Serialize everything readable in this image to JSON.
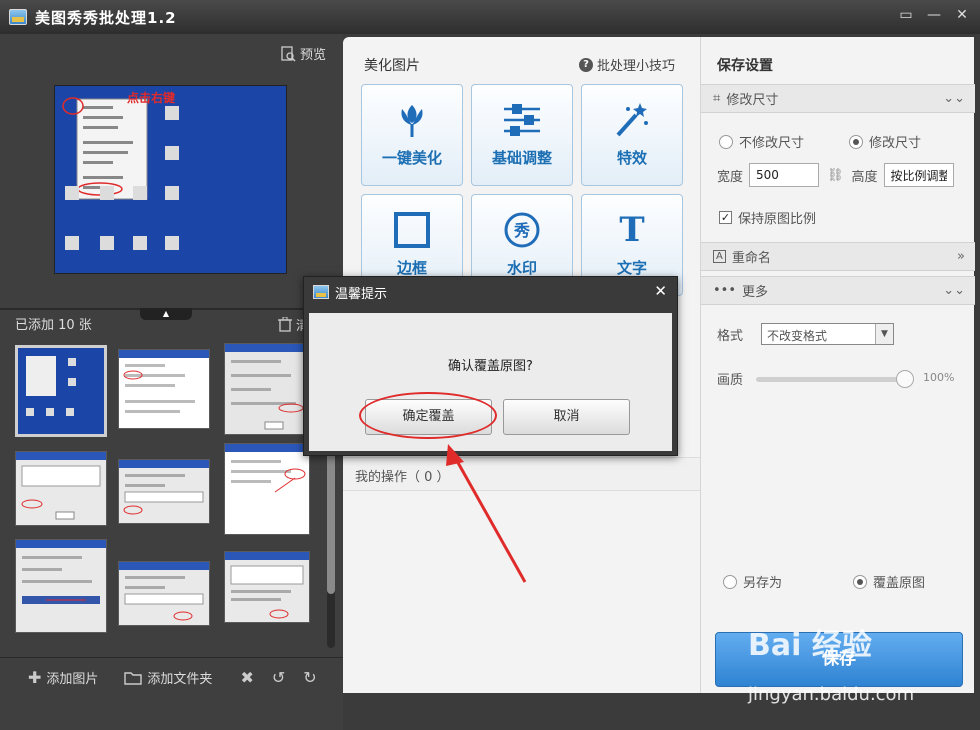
{
  "window": {
    "title": "美图秀秀批处理1.2",
    "buttons": {
      "feedback": "▭",
      "minimize": "—",
      "close": "✕"
    }
  },
  "left_panel": {
    "preview_label": "预览",
    "preview_image_text": "点击右键",
    "added_count": "已添加 10 张",
    "clear_label": "清",
    "thumbnail_count": 9,
    "bottom": {
      "add_image": "添加图片",
      "add_folder": "添加文件夹"
    }
  },
  "center_panel": {
    "title": "美化图片",
    "tips": "批处理小技巧",
    "tiles": [
      {
        "label": "一键美化",
        "icon": "tulip-icon"
      },
      {
        "label": "基础调整",
        "icon": "sliders-icon"
      },
      {
        "label": "特效",
        "icon": "magic-wand-icon"
      },
      {
        "label": "边框",
        "icon": "frame-icon"
      },
      {
        "label": "水印",
        "icon": "watermark-icon"
      },
      {
        "label": "文字",
        "icon": "text-icon"
      }
    ],
    "operations_label": "我的操作（ 0 ）"
  },
  "right_panel": {
    "title": "保存设置",
    "resize_section": "修改尺寸",
    "no_resize": "不修改尺寸",
    "resize": "修改尺寸",
    "width_label": "宽度",
    "width_value": "500",
    "height_label": "高度",
    "height_value": "按比例调整",
    "keep_ratio": "保持原图比例",
    "rename_section": "重命名",
    "more_section": "更多",
    "format_label": "格式",
    "format_value": "不改变格式",
    "quality_label": "画质",
    "quality_value": "100%",
    "quality_level": 1.0,
    "save_as": "另存为",
    "overwrite": "覆盖原图",
    "save_button": "保存"
  },
  "dialog": {
    "title": "温馨提示",
    "message": "确认覆盖原图?",
    "confirm": "确定覆盖",
    "cancel": "取消"
  },
  "watermark": {
    "brand": "Bai 经验",
    "url": "jingyan.baidu.com"
  },
  "colors": {
    "accent": "#2f83d2",
    "annotation": "#e02b2b",
    "tile_text": "#1c6fb3"
  }
}
